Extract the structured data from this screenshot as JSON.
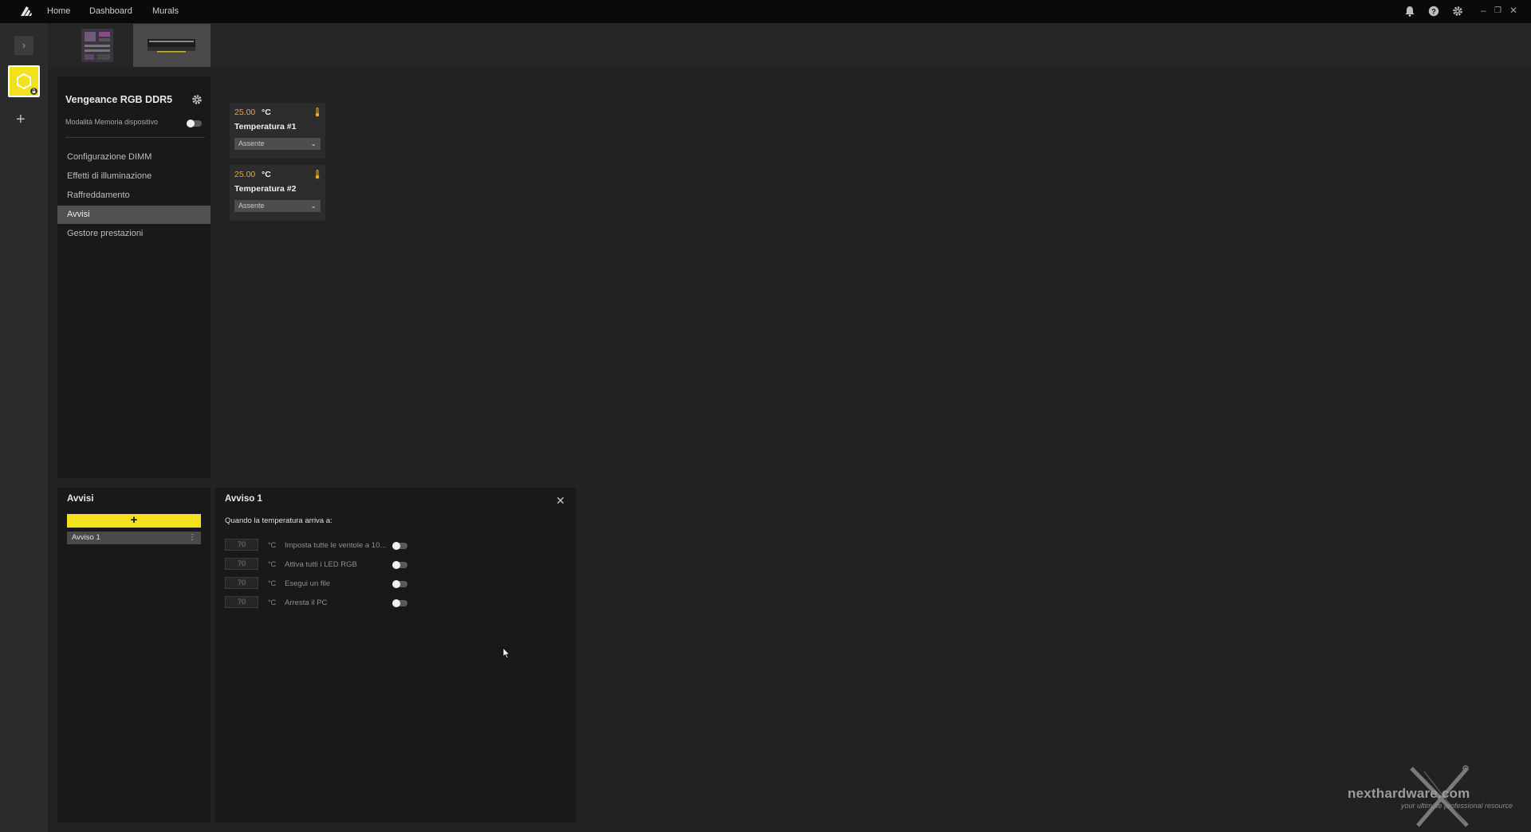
{
  "titlebar": {
    "nav": [
      "Home",
      "Dashboard",
      "Murals"
    ],
    "icons": [
      "bell-icon",
      "help-icon",
      "gear-icon"
    ],
    "window_controls": [
      "–",
      "❐",
      "✕"
    ]
  },
  "sidebar": {
    "device_name": "Vengeance RGB DDR5",
    "memory_mode_label": "Modalità Memoria dispositivo",
    "memory_mode_enabled": false,
    "items": [
      {
        "label": "Configurazione DIMM",
        "active": false
      },
      {
        "label": "Effetti di illuminazione",
        "active": false
      },
      {
        "label": "Raffreddamento",
        "active": false
      },
      {
        "label": "Avvisi",
        "active": true
      },
      {
        "label": "Gestore prestazioni",
        "active": false
      }
    ]
  },
  "sensors": [
    {
      "value": "25.00",
      "unit": "°C",
      "name": "Temperatura #1",
      "selected": "Assente"
    },
    {
      "value": "25.00",
      "unit": "°C",
      "name": "Temperatura #2",
      "selected": "Assente"
    }
  ],
  "alerts_panel": {
    "title": "Avvisi",
    "add_label": "+",
    "items": [
      "Avviso 1"
    ]
  },
  "alert_detail": {
    "title": "Avviso 1",
    "subtitle": "Quando la temperatura arriva a:",
    "rules": [
      {
        "threshold": "70",
        "unit": "°C",
        "action": "Imposta tutte le ventole a 10...",
        "enabled": false
      },
      {
        "threshold": "70",
        "unit": "°C",
        "action": "Attiva tutti i LED RGB",
        "enabled": false
      },
      {
        "threshold": "70",
        "unit": "°C",
        "action": "Esegui un file",
        "enabled": false
      },
      {
        "threshold": "70",
        "unit": "°C",
        "action": "Arresta il PC",
        "enabled": false
      }
    ]
  },
  "watermark": {
    "text": "nexthardware.com",
    "tagline": "your ultimate professional resource"
  },
  "colors": {
    "accent": "#f3e11f",
    "temp_value": "#f5a623",
    "background": "#222222",
    "panel": "#191919"
  }
}
